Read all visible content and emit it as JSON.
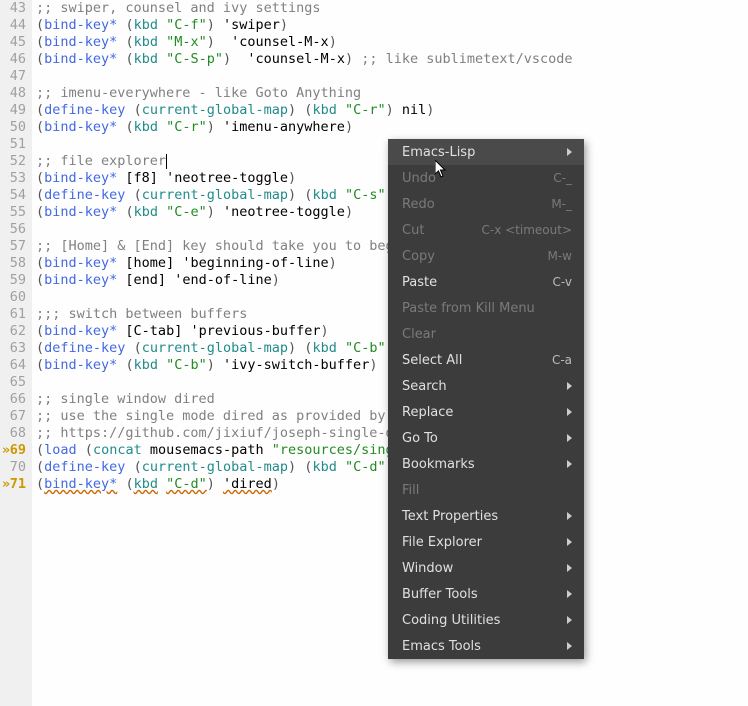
{
  "gutter": {
    "start": 43,
    "end": 71,
    "marks": [
      69,
      71
    ]
  },
  "menu": {
    "items": [
      {
        "label": "Emacs-Lisp",
        "shortcut": "",
        "submenu": true,
        "disabled": false,
        "highlight": true
      },
      {
        "label": "Undo",
        "shortcut": "C-_",
        "submenu": false,
        "disabled": true
      },
      {
        "label": "Redo",
        "shortcut": "M-_",
        "submenu": false,
        "disabled": true
      },
      {
        "label": "Cut",
        "shortcut": "C-x <timeout>",
        "submenu": false,
        "disabled": true
      },
      {
        "label": "Copy",
        "shortcut": "M-w",
        "submenu": false,
        "disabled": true
      },
      {
        "label": "Paste",
        "shortcut": "C-v",
        "submenu": false,
        "disabled": false
      },
      {
        "label": "Paste from Kill Menu",
        "shortcut": "",
        "submenu": false,
        "disabled": true
      },
      {
        "label": "Clear",
        "shortcut": "",
        "submenu": false,
        "disabled": true
      },
      {
        "label": "Select All",
        "shortcut": "C-a",
        "submenu": false,
        "disabled": false
      },
      {
        "label": "Search",
        "shortcut": "",
        "submenu": true,
        "disabled": false
      },
      {
        "label": "Replace",
        "shortcut": "",
        "submenu": true,
        "disabled": false
      },
      {
        "label": "Go To",
        "shortcut": "",
        "submenu": true,
        "disabled": false
      },
      {
        "label": "Bookmarks",
        "shortcut": "",
        "submenu": true,
        "disabled": false
      },
      {
        "label": "Fill",
        "shortcut": "",
        "submenu": false,
        "disabled": true
      },
      {
        "label": "Text Properties",
        "shortcut": "",
        "submenu": true,
        "disabled": false
      },
      {
        "label": "File Explorer",
        "shortcut": "",
        "submenu": true,
        "disabled": false
      },
      {
        "label": "Window",
        "shortcut": "",
        "submenu": true,
        "disabled": false
      },
      {
        "label": "Buffer Tools",
        "shortcut": "",
        "submenu": true,
        "disabled": false
      },
      {
        "label": "Coding Utilities",
        "shortcut": "",
        "submenu": true,
        "disabled": false
      },
      {
        "label": "Emacs Tools",
        "shortcut": "",
        "submenu": true,
        "disabled": false
      }
    ]
  },
  "code": {
    "l43": {
      "cmt": ";; swiper, counsel and ivy settings"
    },
    "l44": {
      "fn": "bind-key*",
      "kbd": "kbd",
      "str": "\"C-f\"",
      "sym": "'swiper"
    },
    "l45": {
      "fn": "bind-key*",
      "kbd": "kbd",
      "str": "\"M-x\"",
      "sym": "'counsel-M-x"
    },
    "l46": {
      "fn": "bind-key*",
      "kbd": "kbd",
      "str": "\"C-S-p\"",
      "sym": "'counsel-M-x",
      "tail": ";; like sublimetext/vscode"
    },
    "l48": {
      "cmt": ";; imenu-everywhere - like Goto Anything"
    },
    "l49": {
      "fn": "define-key",
      "cgm": "current-global-map",
      "kbd": "kbd",
      "str": "\"C-r\"",
      "sym": "nil"
    },
    "l50": {
      "fn": "bind-key*",
      "kbd": "kbd",
      "str": "\"C-r\"",
      "sym": "'imenu-anywhere"
    },
    "l52": {
      "cmt": ";; file explorer"
    },
    "l53": {
      "fn": "bind-key*",
      "arg": "[f8]",
      "sym": "'neotree-toggle"
    },
    "l54": {
      "fn": "define-key",
      "cgm": "current-global-map",
      "kbd": "kbd",
      "str": "\"C-s\""
    },
    "l55": {
      "fn": "bind-key*",
      "kbd": "kbd",
      "str": "\"C-e\"",
      "sym": "'neotree-toggle"
    },
    "l57": {
      "cmt": ";; [Home] & [End] key should take you to beg"
    },
    "l58": {
      "fn": "bind-key*",
      "arg": "[home]",
      "sym": "'beginning-of-line"
    },
    "l59": {
      "fn": "bind-key*",
      "arg": "[end]",
      "sym": "'end-of-line"
    },
    "l61": {
      "cmt": ";;; switch between buffers"
    },
    "l62": {
      "fn": "bind-key*",
      "arg": "[C-tab]",
      "sym": "'previous-buffer"
    },
    "l63": {
      "fn": "define-key",
      "cgm": "current-global-map",
      "kbd": "kbd",
      "str": "\"C-b\""
    },
    "l64": {
      "fn": "bind-key*",
      "kbd": "kbd",
      "str": "\"C-b\"",
      "sym": "'ivy-switch-buffer"
    },
    "l66": {
      "cmt": ";; single window dired"
    },
    "l67": {
      "cmt": ";; use the single mode dired as provided by "
    },
    "l68": {
      "cmt": ";; https://github.com/jixiuf/joseph-single-d"
    },
    "l69": {
      "fn": "load",
      "concat": "concat",
      "var": "mousemacs-path",
      "str": "\"resources/sing"
    },
    "l70": {
      "fn": "define-key",
      "cgm": "current-global-map",
      "kbd": "kbd",
      "str": "\"C-d\""
    },
    "l71": {
      "fn": "bind-key*",
      "kbd": "kbd",
      "str": "\"C-d\"",
      "sym": "'dired"
    }
  }
}
